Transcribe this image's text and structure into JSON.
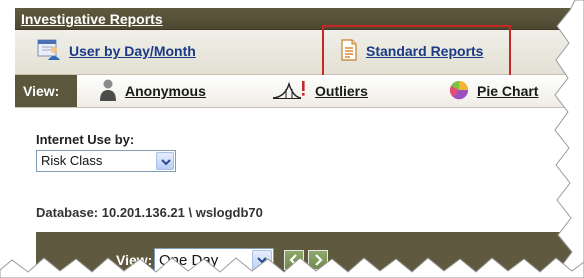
{
  "header": {
    "title": "Investigative Reports"
  },
  "report_tabs": [
    {
      "label": "User by Day/Month",
      "icon": "user-calendar-icon"
    },
    {
      "label": "Standard Reports",
      "icon": "document-icon"
    }
  ],
  "view_bar": {
    "label": "View:",
    "items": [
      {
        "label": "Anonymous",
        "icon": "person-icon"
      },
      {
        "label": "Outliers",
        "icon": "outliers-icon"
      },
      {
        "label": "Pie Chart",
        "icon": "pie-chart-icon"
      }
    ]
  },
  "filters": {
    "internet_use_label": "Internet Use by:",
    "internet_use_value": "Risk Class",
    "database_line": "Database:  10.201.136.21 \\ wslogdb70"
  },
  "period_bar": {
    "label": "View:",
    "value": "One Day"
  },
  "colors": {
    "header_bg": "#5f5a3e",
    "link": "#1a3a86",
    "highlight": "#c62828"
  }
}
